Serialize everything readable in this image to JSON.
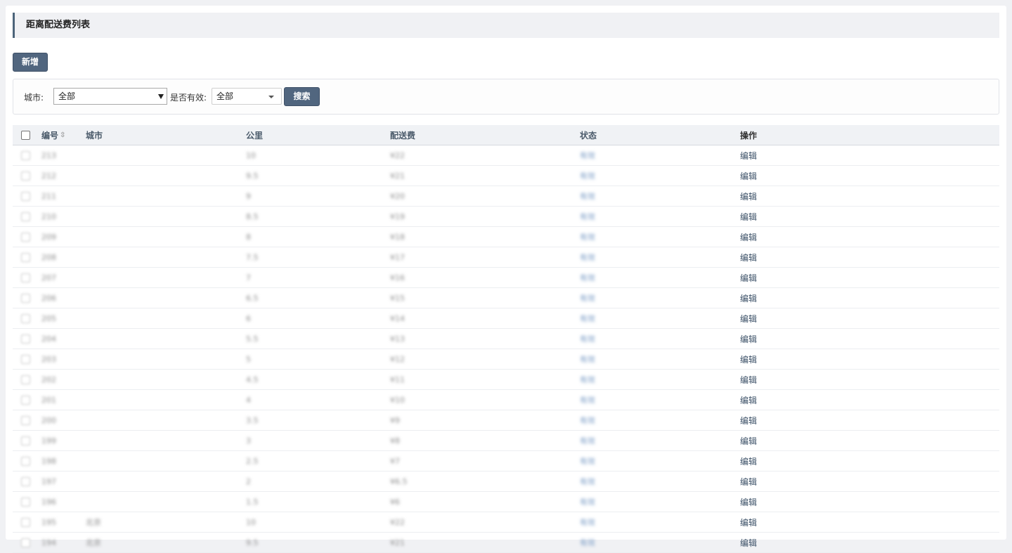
{
  "page": {
    "title": "距离配送费列表"
  },
  "toolbar": {
    "add_label": "新增"
  },
  "filters": {
    "city_label": "城市:",
    "city_value": "全部",
    "valid_label": "是否有效:",
    "valid_value": "全部",
    "search_label": "搜索"
  },
  "table": {
    "columns": {
      "id": "编号",
      "id_sort_icon": "⇳",
      "city": "城市",
      "km": "公里",
      "fee": "配送费",
      "status": "状态",
      "op": "操作"
    },
    "rows": [
      {
        "id": "213",
        "city": "",
        "km": "10",
        "fee": "¥22",
        "status": "有效",
        "op": "编辑"
      },
      {
        "id": "212",
        "city": "",
        "km": "9.5",
        "fee": "¥21",
        "status": "有效",
        "op": "编辑"
      },
      {
        "id": "211",
        "city": "",
        "km": "9",
        "fee": "¥20",
        "status": "有效",
        "op": "编辑"
      },
      {
        "id": "210",
        "city": "",
        "km": "8.5",
        "fee": "¥19",
        "status": "有效",
        "op": "编辑"
      },
      {
        "id": "209",
        "city": "",
        "km": "8",
        "fee": "¥18",
        "status": "有效",
        "op": "编辑"
      },
      {
        "id": "208",
        "city": "",
        "km": "7.5",
        "fee": "¥17",
        "status": "有效",
        "op": "编辑"
      },
      {
        "id": "207",
        "city": "",
        "km": "7",
        "fee": "¥16",
        "status": "有效",
        "op": "编辑"
      },
      {
        "id": "206",
        "city": "",
        "km": "6.5",
        "fee": "¥15",
        "status": "有效",
        "op": "编辑"
      },
      {
        "id": "205",
        "city": "",
        "km": "6",
        "fee": "¥14",
        "status": "有效",
        "op": "编辑"
      },
      {
        "id": "204",
        "city": "",
        "km": "5.5",
        "fee": "¥13",
        "status": "有效",
        "op": "编辑"
      },
      {
        "id": "203",
        "city": "",
        "km": "5",
        "fee": "¥12",
        "status": "有效",
        "op": "编辑"
      },
      {
        "id": "202",
        "city": "",
        "km": "4.5",
        "fee": "¥11",
        "status": "有效",
        "op": "编辑"
      },
      {
        "id": "201",
        "city": "",
        "km": "4",
        "fee": "¥10",
        "status": "有效",
        "op": "编辑"
      },
      {
        "id": "200",
        "city": "",
        "km": "3.5",
        "fee": "¥9",
        "status": "有效",
        "op": "编辑"
      },
      {
        "id": "199",
        "city": "",
        "km": "3",
        "fee": "¥8",
        "status": "有效",
        "op": "编辑"
      },
      {
        "id": "198",
        "city": "",
        "km": "2.5",
        "fee": "¥7",
        "status": "有效",
        "op": "编辑"
      },
      {
        "id": "197",
        "city": "",
        "km": "2",
        "fee": "¥6.5",
        "status": "有效",
        "op": "编辑"
      },
      {
        "id": "196",
        "city": "",
        "km": "1.5",
        "fee": "¥6",
        "status": "有效",
        "op": "编辑"
      },
      {
        "id": "195",
        "city": "北京",
        "km": "10",
        "fee": "¥22",
        "status": "有效",
        "op": "编辑"
      },
      {
        "id": "194",
        "city": "北京",
        "km": "9.5",
        "fee": "¥21",
        "status": "有效",
        "op": "编辑"
      }
    ]
  }
}
